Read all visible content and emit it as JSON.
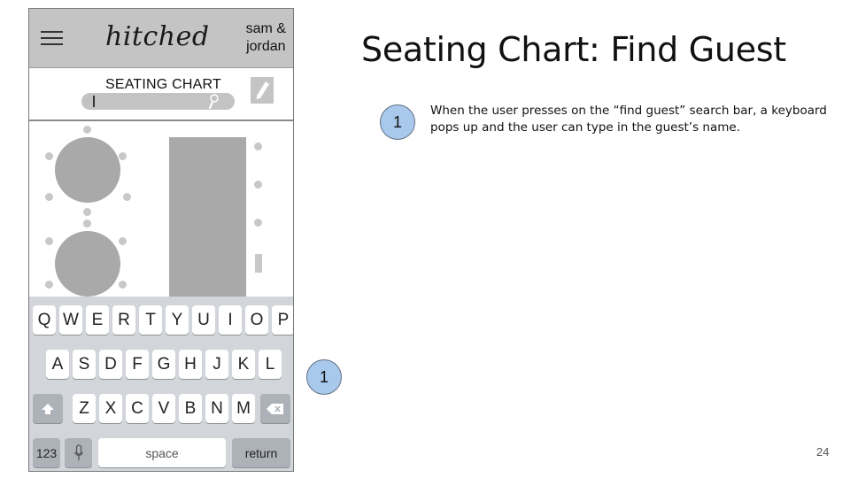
{
  "slide": {
    "title": "Seating Chart: Find Guest",
    "page_number": "24",
    "annotations": [
      {
        "number": "1",
        "text": "When the user presses on the “find guest” search bar, a keyboard pops up and the user can type in the guest’s name."
      }
    ],
    "callout_marker": "1",
    "badge_color": "#a8c8ec"
  },
  "app": {
    "logo": "hitched",
    "couple_line1": "sam &",
    "couple_line2": "jordan",
    "menu_icon": "hamburger-icon",
    "section_title": "SEATING CHART",
    "search": {
      "value": "",
      "icon": "search-icon"
    },
    "edit_icon": "pencil-icon",
    "colors": {
      "header": "#c4c4c4",
      "table": "#a9a9a9",
      "seat": "#c8c8c8"
    }
  },
  "keyboard": {
    "row1": [
      "Q",
      "W",
      "E",
      "R",
      "T",
      "Y",
      "U",
      "I",
      "O",
      "P"
    ],
    "row2": [
      "A",
      "S",
      "D",
      "F",
      "G",
      "H",
      "J",
      "K",
      "L"
    ],
    "row3": [
      "Z",
      "X",
      "C",
      "V",
      "B",
      "N",
      "M"
    ],
    "shift_icon": "shift-icon",
    "delete_icon": "backspace-icon",
    "numbers_label": "123",
    "mic_icon": "microphone-icon",
    "space_label": "space",
    "return_label": "return"
  }
}
